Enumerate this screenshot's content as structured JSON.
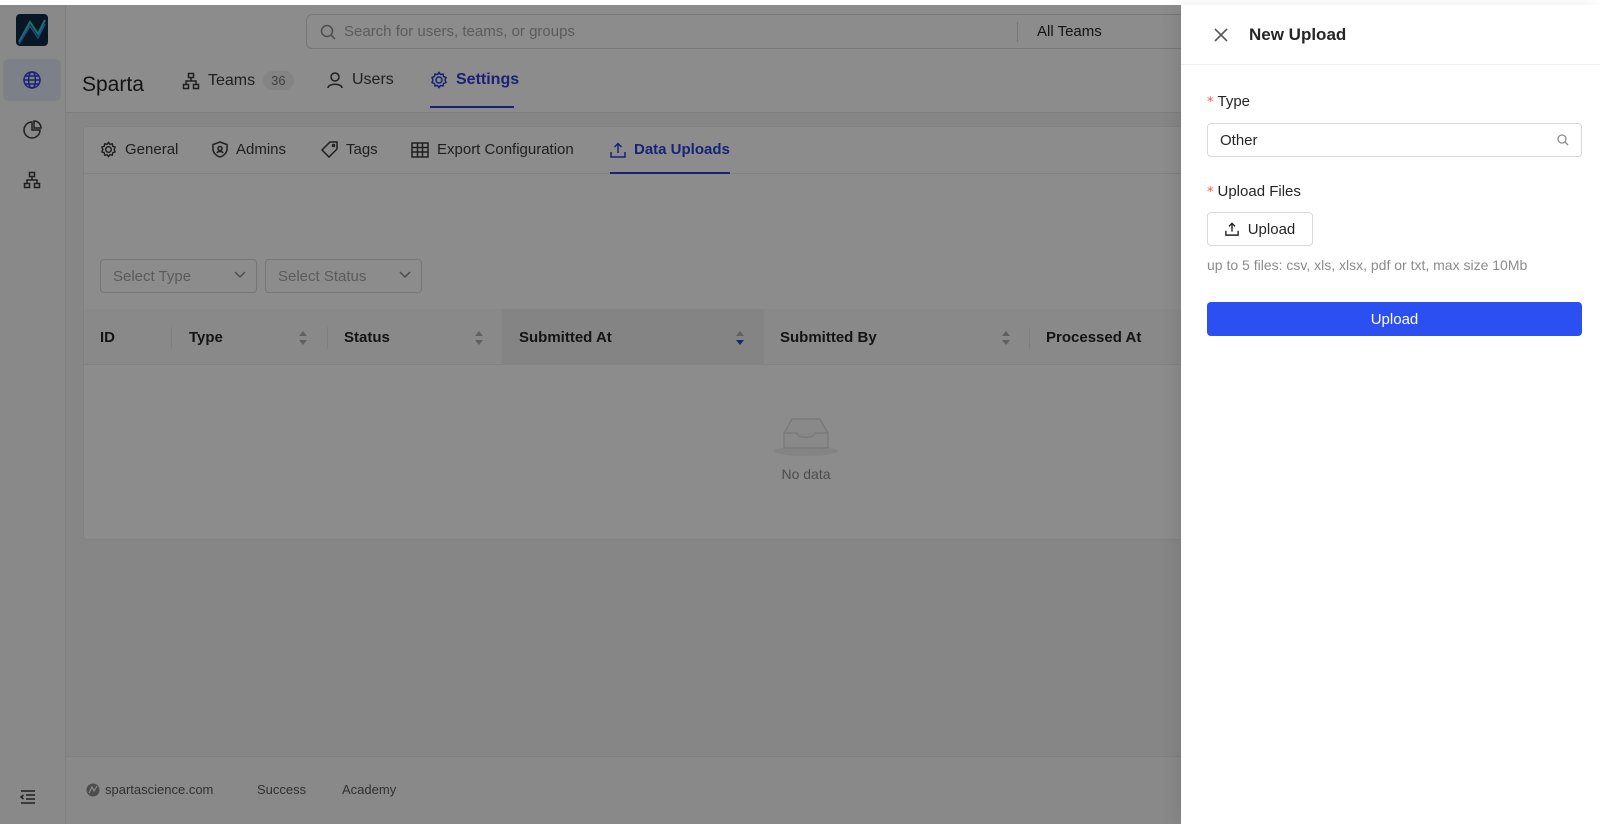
{
  "header": {
    "search_placeholder": "Search for users, teams, or groups",
    "team_filter": "All Teams",
    "brand": "Sparta",
    "nav": [
      {
        "label": "Teams",
        "badge": "36"
      },
      {
        "label": "Users"
      },
      {
        "label": "Settings"
      }
    ]
  },
  "settings_tabs": [
    "General",
    "Admins",
    "Tags",
    "Export Configuration",
    "Data Uploads"
  ],
  "filters": {
    "type_placeholder": "Select Type",
    "status_placeholder": "Select Status"
  },
  "table": {
    "columns": [
      "ID",
      "Type",
      "Status",
      "Submitted At",
      "Submitted By",
      "Processed At"
    ],
    "empty_text": "No data"
  },
  "footer": {
    "site": "spartascience.com",
    "links": [
      "Success",
      "Academy"
    ]
  },
  "drawer": {
    "title": "New Upload",
    "type_label": "Type",
    "type_value": "Other",
    "upload_files_label": "Upload Files",
    "upload_button": "Upload",
    "hint": "up to 5 files: csv, xls, xlsx, pdf or txt, max size 10Mb",
    "submit_button": "Upload",
    "required_mark": "*"
  },
  "colors": {
    "accent": "#2c3fd8",
    "primary_button": "#2b4ff0",
    "required": "#ff4d4f"
  }
}
